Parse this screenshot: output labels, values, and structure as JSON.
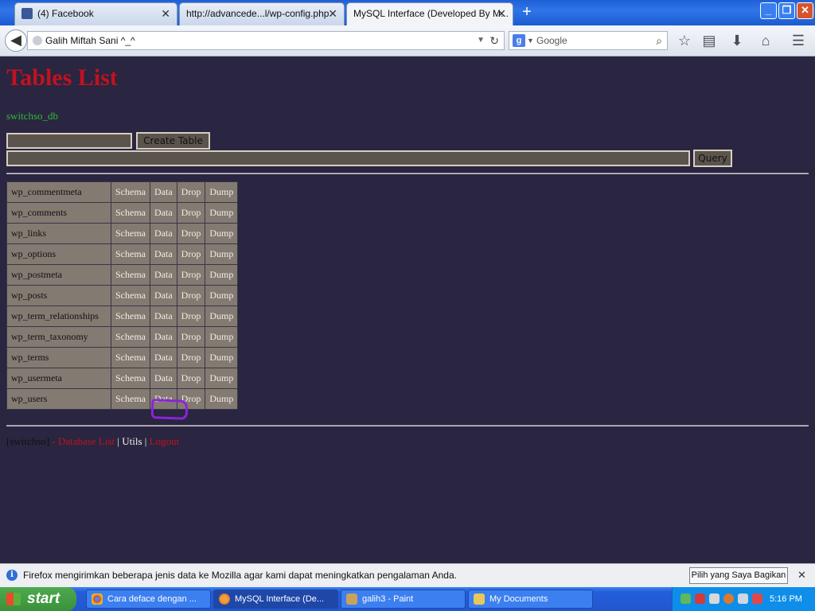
{
  "browser": {
    "tabs": [
      {
        "label": "(4) Facebook",
        "close": "✕",
        "active": false
      },
      {
        "label": "http://advancede...l/wp-config.php",
        "close": "✕",
        "active": false
      },
      {
        "label": "MySQL Interface (Developed By M...",
        "close": "✕",
        "active": true
      }
    ],
    "new_tab": "+",
    "url": "Galih Miftah Sani ^_^",
    "search_placeholder": "Google",
    "window_buttons": {
      "minimize": "_",
      "maximize": "❐",
      "close": "✕"
    }
  },
  "page": {
    "title": "Tables List",
    "database": "switchso_db",
    "create_table_button": "Create Table",
    "query_button": "Query",
    "tables": [
      {
        "name": "wp_commentmeta",
        "links": [
          "Schema",
          "Data",
          "Drop",
          "Dump"
        ]
      },
      {
        "name": "wp_comments",
        "links": [
          "Schema",
          "Data",
          "Drop",
          "Dump"
        ]
      },
      {
        "name": "wp_links",
        "links": [
          "Schema",
          "Data",
          "Drop",
          "Dump"
        ]
      },
      {
        "name": "wp_options",
        "links": [
          "Schema",
          "Data",
          "Drop",
          "Dump"
        ]
      },
      {
        "name": "wp_postmeta",
        "links": [
          "Schema",
          "Data",
          "Drop",
          "Dump"
        ]
      },
      {
        "name": "wp_posts",
        "links": [
          "Schema",
          "Data",
          "Drop",
          "Dump"
        ]
      },
      {
        "name": "wp_term_relationships",
        "links": [
          "Schema",
          "Data",
          "Drop",
          "Dump"
        ]
      },
      {
        "name": "wp_term_taxonomy",
        "links": [
          "Schema",
          "Data",
          "Drop",
          "Dump"
        ]
      },
      {
        "name": "wp_terms",
        "links": [
          "Schema",
          "Data",
          "Drop",
          "Dump"
        ]
      },
      {
        "name": "wp_usermeta",
        "links": [
          "Schema",
          "Data",
          "Drop",
          "Dump"
        ]
      },
      {
        "name": "wp_users",
        "links": [
          "Schema",
          "Data",
          "Drop",
          "Dump"
        ]
      }
    ],
    "footer": {
      "user": "[switchso]",
      "separator": " - ",
      "database_list": "Database List",
      "pipe": " | ",
      "utils": "Utils",
      "logout": "Logout"
    }
  },
  "notification": {
    "message": "Firefox mengirimkan beberapa jenis data ke Mozilla agar kami dapat meningkatkan pengalaman Anda.",
    "button": "Pilih yang Saya Bagikan",
    "close": "✕"
  },
  "taskbar": {
    "start": "start",
    "tasks": [
      {
        "label": "Cara deface dengan ...",
        "icon": "chrome-icon",
        "active": false
      },
      {
        "label": "MySQL Interface (De...",
        "icon": "firefox-icon",
        "active": true
      },
      {
        "label": "galih3 - Paint",
        "icon": "paint-icon",
        "active": false
      },
      {
        "label": "My Documents",
        "icon": "folder-icon",
        "active": false
      }
    ],
    "clock": "5:16 PM"
  },
  "colors": {
    "page_bg": "#2a2540",
    "title_red": "#c1121f",
    "db_green": "#2dbb3a",
    "cell_bg": "#837a72",
    "highlight_purple": "#8a24d8"
  }
}
